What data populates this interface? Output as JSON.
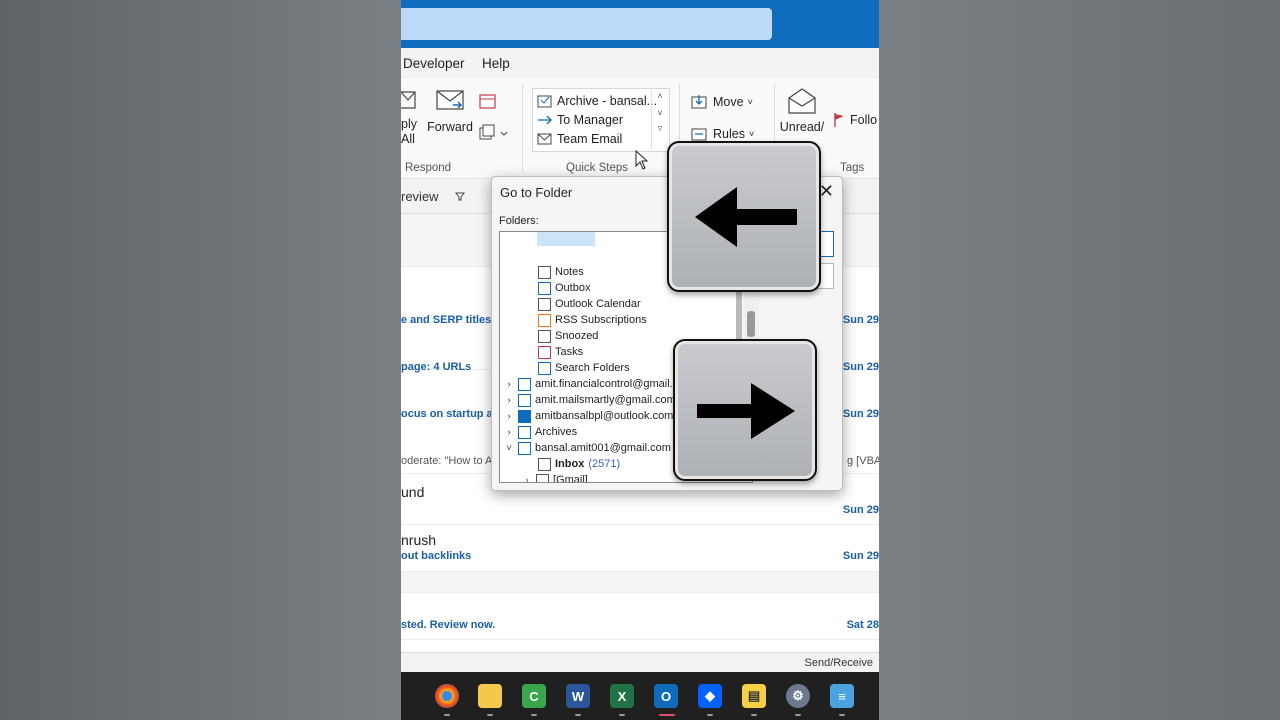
{
  "menu": {
    "developer": "Developer",
    "help": "Help"
  },
  "ribbon": {
    "reply_all_l1": "ply",
    "reply_all_l2": "All",
    "forward": "Forward",
    "respond_group": "Respond",
    "quick_steps": {
      "items": [
        "Archive - bansal...",
        "To Manager",
        "Team Email"
      ],
      "group": "Quick Steps"
    },
    "move": "Move",
    "rules": "Rules",
    "unread_read": "Unread/",
    "follow": "Follo",
    "tags_group": "Tags"
  },
  "list_header": {
    "view_label": "review"
  },
  "messages": [
    {
      "subject": "e and SERP titles d",
      "date": "Sun 29"
    },
    {
      "subject": "page: 4 URLs",
      "date": "Sun 29"
    },
    {
      "subject": "ocus on startup ag",
      "date": "Sun 29"
    },
    {
      "snippet": "oderate: \"How to Aut",
      "snippet_right": "g [VBA ..."
    },
    {
      "sender": "und",
      "date": "Sun 29"
    },
    {
      "sender": "nrush",
      "subject": "out backlinks",
      "date": "Sun 29"
    },
    {
      "subject": "sted. Review now.",
      "date": "Sat 28"
    }
  ],
  "status": {
    "send_receive": "Send/Receive"
  },
  "dialog": {
    "title": "Go to Folder",
    "close": "✕",
    "folders_label": "Folders:",
    "tree": [
      {
        "label": "Notes"
      },
      {
        "label": "Outbox"
      },
      {
        "label": "Outlook Calendar"
      },
      {
        "label": "RSS Subscriptions"
      },
      {
        "label": "Snoozed"
      },
      {
        "label": "Tasks"
      },
      {
        "label": "Search Folders"
      },
      {
        "label": "amit.financialcontrol@gmail.c"
      },
      {
        "label": "amit.mailsmartly@gmail.com"
      },
      {
        "label": "amitbansalbpl@outlook.com"
      },
      {
        "label": "Archives"
      },
      {
        "label": "bansal.amit001@gmail.com"
      },
      {
        "label": "Inbox",
        "count": "(2571)"
      },
      {
        "label": "[Gmail]"
      }
    ]
  },
  "taskbar_icons": [
    "chrome-icon",
    "file-explorer-icon",
    "camtasia-icon",
    "word-icon",
    "excel-icon",
    "outlook-icon",
    "dropbox-icon",
    "sticky-notes-icon",
    "settings-icon",
    "notepad-icon"
  ],
  "colors": {
    "accent": "#0f6cbd",
    "link_blue": "#1a5fa6",
    "search_bg": "#bcd9f7"
  }
}
